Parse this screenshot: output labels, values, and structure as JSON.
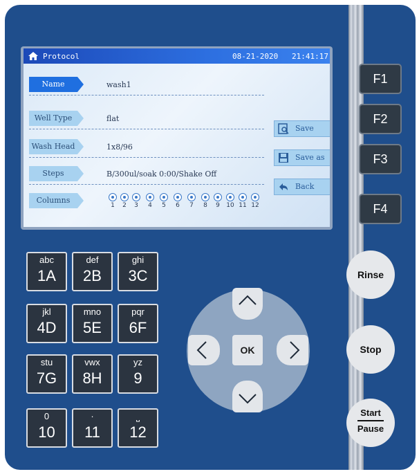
{
  "header": {
    "title": "Protocol",
    "date": "08-21-2020",
    "time": "21:41:17"
  },
  "fields": [
    {
      "label": "Name",
      "value": "wash1",
      "active": true
    },
    {
      "label": "Well Type",
      "value": "flat",
      "active": false
    },
    {
      "label": "Wash Head",
      "value": "1x8/96",
      "active": false
    },
    {
      "label": "Steps",
      "value": "B/300ul/soak 0:00/Shake Off",
      "active": false
    },
    {
      "label": "Columns",
      "value": "",
      "active": false
    }
  ],
  "columns": [
    "1",
    "2",
    "3",
    "4",
    "5",
    "6",
    "7",
    "8",
    "9",
    "10",
    "11",
    "12"
  ],
  "screen_buttons": [
    {
      "label": "Save",
      "icon": "save-search-icon"
    },
    {
      "label": "Save as",
      "icon": "floppy-disk-icon"
    },
    {
      "label": "Back",
      "icon": "back-arrow-icon"
    }
  ],
  "function_keys": [
    "F1",
    "F2",
    "F3",
    "F4"
  ],
  "keypad": [
    {
      "small": "abc",
      "big": "1A"
    },
    {
      "small": "def",
      "big": "2B"
    },
    {
      "small": "ghi",
      "big": "3C"
    },
    {
      "small": "jkl",
      "big": "4D"
    },
    {
      "small": "mno",
      "big": "5E"
    },
    {
      "small": "pqr",
      "big": "6F"
    },
    {
      "small": "stu",
      "big": "7G"
    },
    {
      "small": "vwx",
      "big": "8H"
    },
    {
      "small": "yz",
      "big": "9"
    },
    {
      "small": "0",
      "big": "10"
    },
    {
      "small": "·",
      "big": "11"
    },
    {
      "small": "⎵",
      "big": "12"
    }
  ],
  "dpad": {
    "ok": "OK"
  },
  "side_buttons": {
    "rinse": "Rinse",
    "stop": "Stop",
    "start": "Start",
    "pause": "Pause"
  },
  "colors": {
    "panel": "#1f4e8c",
    "titlebar": "#2d6fe0",
    "label_active": "#1f6fe0",
    "label": "#a8d2f0"
  }
}
